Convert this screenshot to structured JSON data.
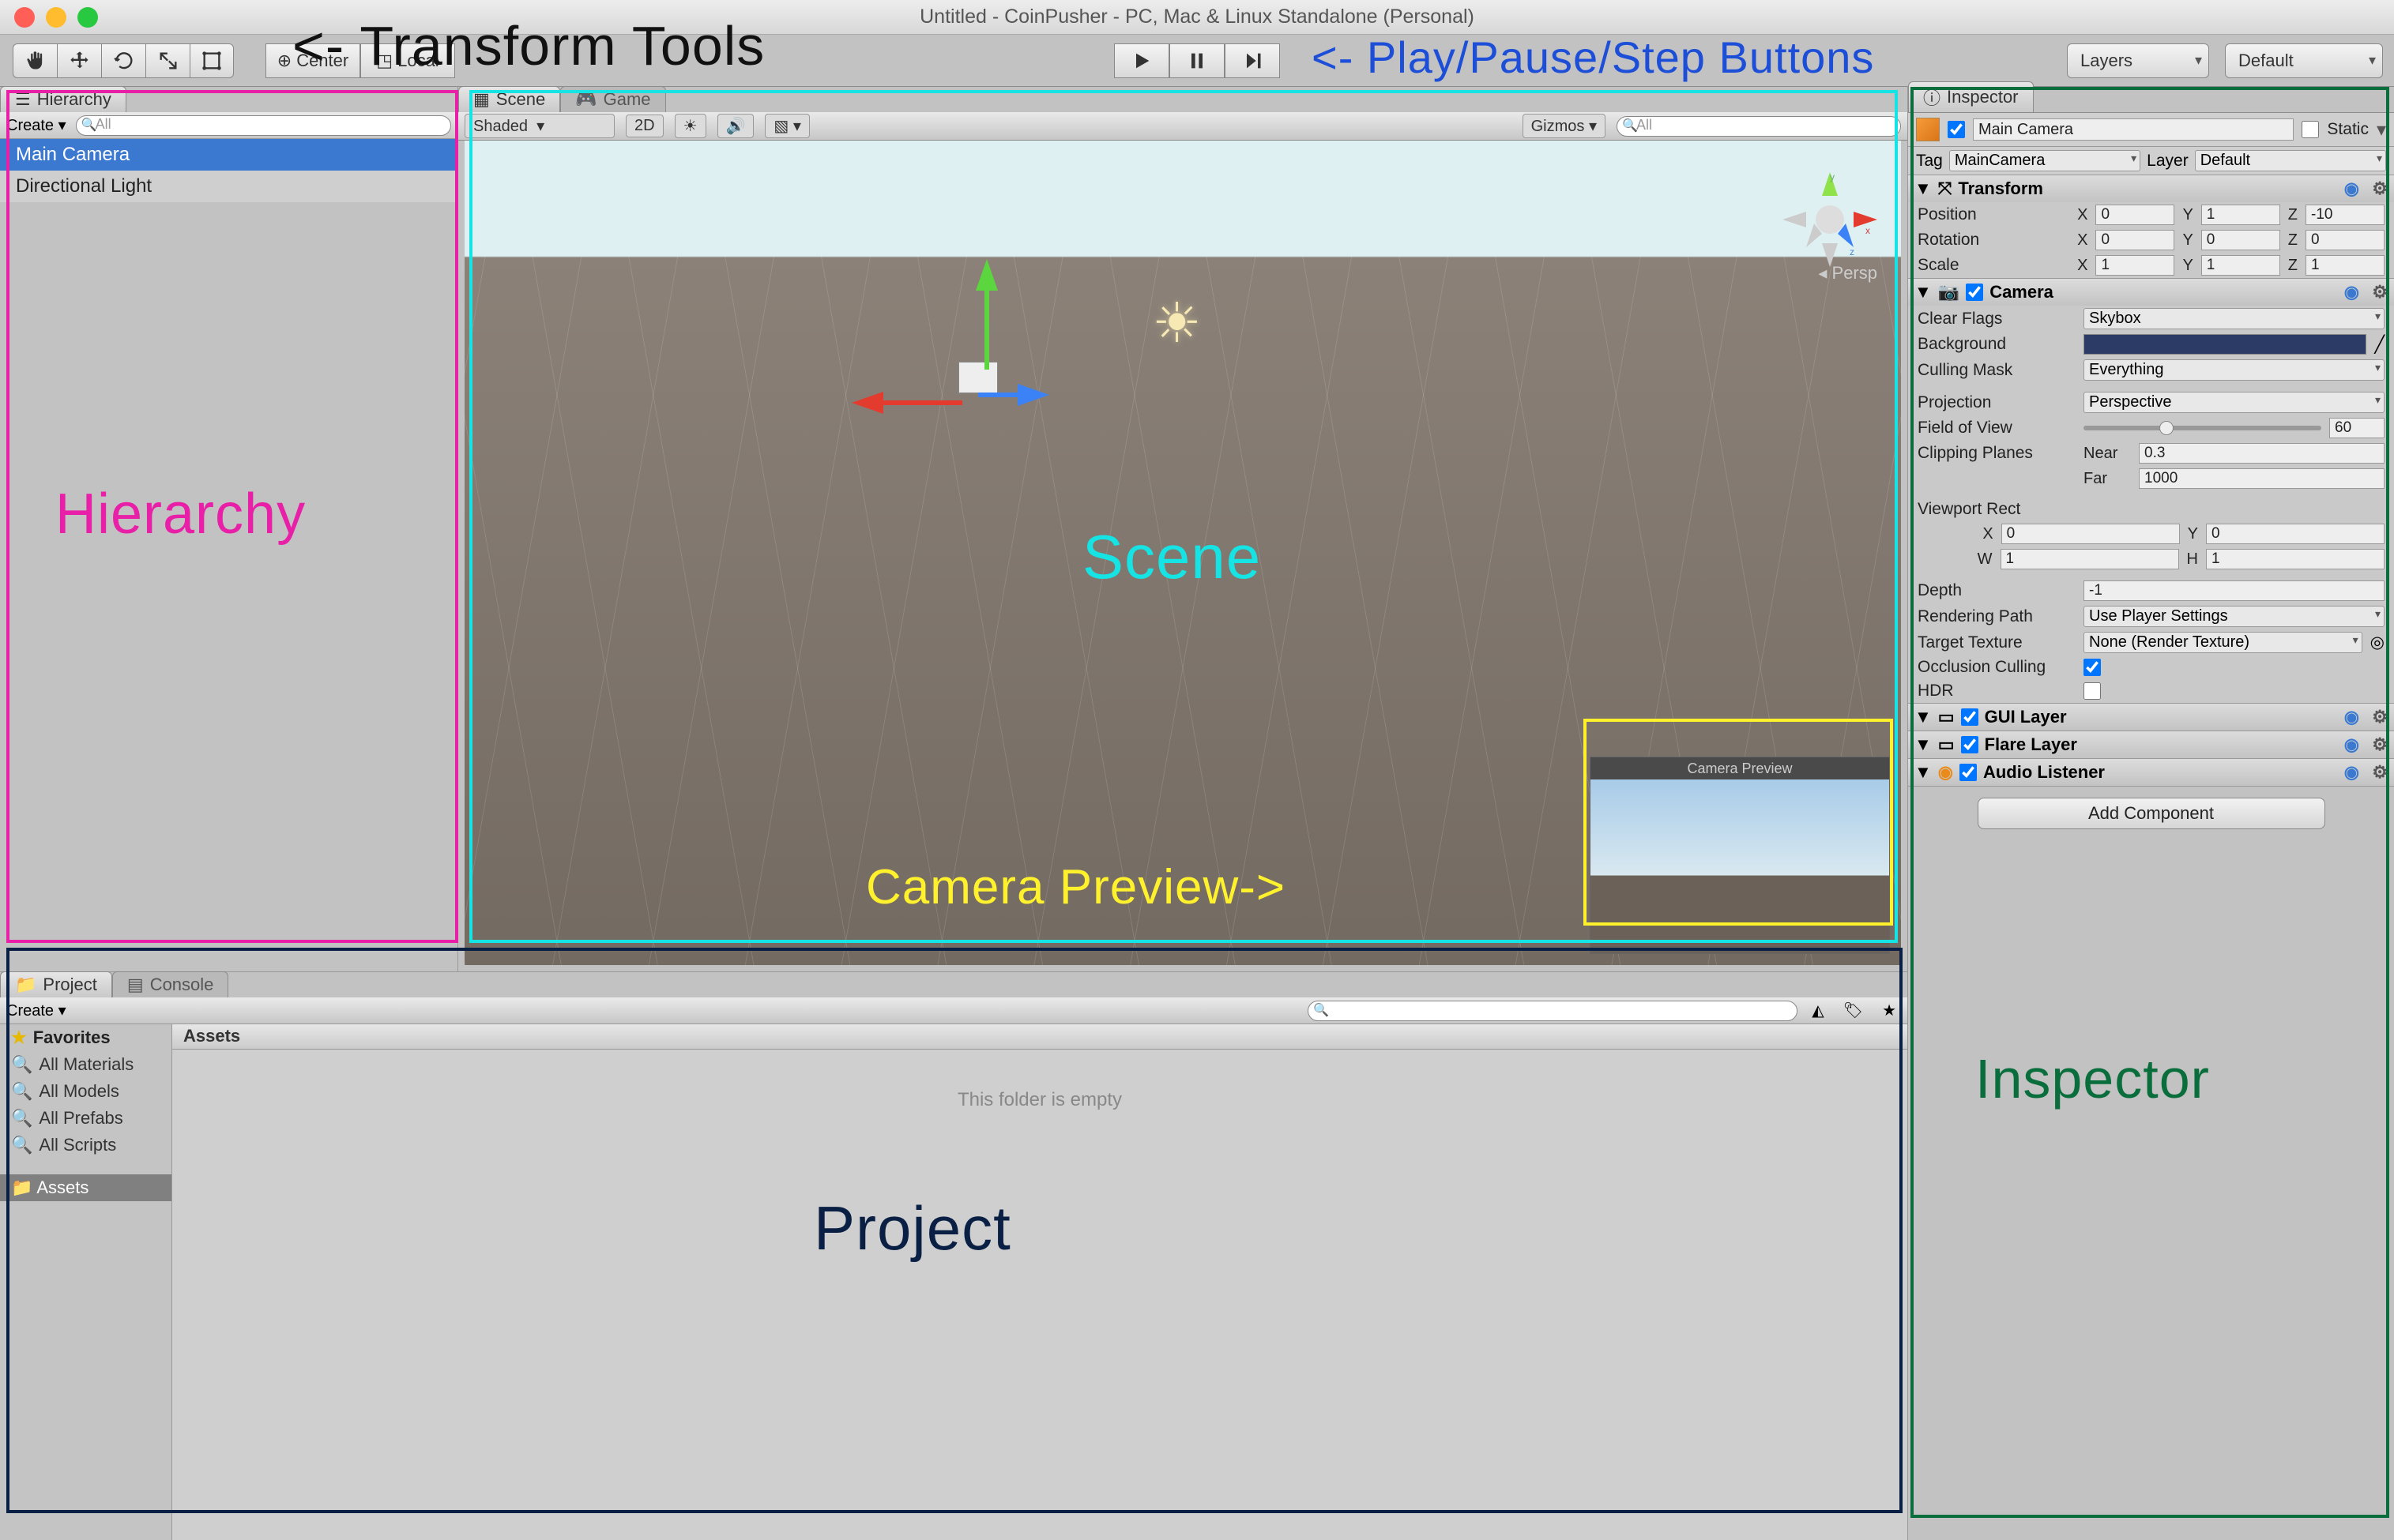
{
  "window": {
    "title": "Untitled - CoinPusher - PC, Mac & Linux Standalone (Personal)"
  },
  "toolbar": {
    "pivot_center": "Center",
    "pivot_local": "Local",
    "layers": "Layers",
    "layout": "Default"
  },
  "hierarchy": {
    "tab": "Hierarchy",
    "create": "Create",
    "search_ph": "All",
    "items": [
      {
        "label": "Main Camera",
        "selected": true
      },
      {
        "label": "Directional Light",
        "selected": false
      }
    ]
  },
  "scene": {
    "tabs": {
      "scene": "Scene",
      "game": "Game"
    },
    "shading": "Shaded",
    "mode2d": "2D",
    "gizmos": "Gizmos",
    "search_ph": "All",
    "persp": "Persp",
    "axes": {
      "x": "x",
      "y": "y",
      "z": "z"
    },
    "preview_title": "Camera Preview"
  },
  "inspector": {
    "tab": "Inspector",
    "name": "Main Camera",
    "static_label": "Static",
    "tag_label": "Tag",
    "tag_value": "MainCamera",
    "layer_label": "Layer",
    "layer_value": "Default",
    "transform": {
      "title": "Transform",
      "position_label": "Position",
      "rotation_label": "Rotation",
      "scale_label": "Scale",
      "position": {
        "x": "0",
        "y": "1",
        "z": "-10"
      },
      "rotation": {
        "x": "0",
        "y": "0",
        "z": "0"
      },
      "scale": {
        "x": "1",
        "y": "1",
        "z": "1"
      }
    },
    "camera": {
      "title": "Camera",
      "clear_flags_label": "Clear Flags",
      "clear_flags": "Skybox",
      "background_label": "Background",
      "culling_label": "Culling Mask",
      "culling": "Everything",
      "projection_label": "Projection",
      "projection": "Perspective",
      "fov_label": "Field of View",
      "fov": "60",
      "clip_label": "Clipping Planes",
      "near_label": "Near",
      "near": "0.3",
      "far_label": "Far",
      "far": "1000",
      "viewport_label": "Viewport Rect",
      "vx": "0",
      "vy": "0",
      "vw": "1",
      "vh": "1",
      "depth_label": "Depth",
      "depth": "-1",
      "renderpath_label": "Rendering Path",
      "renderpath": "Use Player Settings",
      "targettex_label": "Target Texture",
      "targettex": "None (Render Texture)",
      "occlusion_label": "Occlusion Culling",
      "hdr_label": "HDR"
    },
    "gui_layer": "GUI Layer",
    "flare_layer": "Flare Layer",
    "audio_listener": "Audio Listener",
    "add_component": "Add Component"
  },
  "project": {
    "tab_project": "Project",
    "tab_console": "Console",
    "create": "Create",
    "favorites_label": "Favorites",
    "favorites": [
      "All Materials",
      "All Models",
      "All Prefabs",
      "All Scripts"
    ],
    "assets": "Assets",
    "crumb": "Assets",
    "empty_msg": "This folder is empty"
  },
  "annotations": {
    "transform_tools": "<- Transform Tools",
    "play_buttons": "<- Play/Pause/Step Buttons",
    "hierarchy": "Hierarchy",
    "scene": "Scene",
    "camera_preview": "Camera Preview->",
    "inspector": "Inspector",
    "project": "Project"
  }
}
